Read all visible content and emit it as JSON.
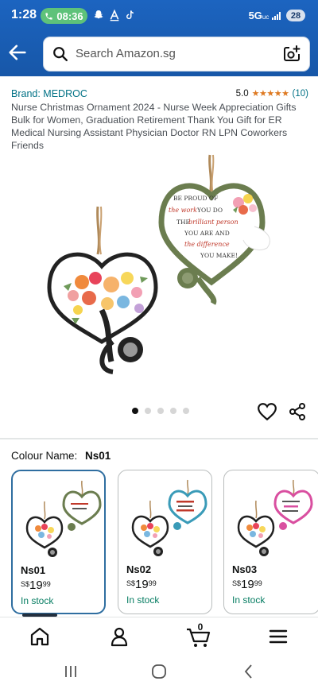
{
  "status_bar": {
    "time": "1:28",
    "call_time": "08:36",
    "network": "5G",
    "network_suffix": "uc",
    "battery": "28"
  },
  "header": {
    "search_placeholder": "Search Amazon.sg"
  },
  "product": {
    "brand": "Brand: MEDROC",
    "rating_value": "5.0",
    "rating_count": "(10)",
    "stars": 5,
    "title": "Nurse Christmas Ornament 2024 - Nurse Week Appreciation Gifts Bulk for Women, Graduation Retirement Thank You Gift for ER Medical Nursing Assistant Physician Doctor RN LPN Coworkers Friends"
  },
  "gallery": {
    "image_count": 5,
    "active_index": 0,
    "ornament_text": [
      "BE PROUD OF",
      "the work",
      "YOU DO",
      "THE",
      "brilliant person",
      "YOU ARE AND",
      "the difference",
      "YOU MAKE!"
    ]
  },
  "colour": {
    "label": "Colour Name:",
    "selected": "Ns01",
    "variants": [
      {
        "name": "Ns01",
        "currency": "S$",
        "whole": "19",
        "fraction": "99",
        "stock": "In stock",
        "accent": "#6b7d4f"
      },
      {
        "name": "Ns02",
        "currency": "S$",
        "whole": "19",
        "fraction": "99",
        "stock": "In stock",
        "accent": "#3a9bb8"
      },
      {
        "name": "Ns03",
        "currency": "S$",
        "whole": "19",
        "fraction": "99",
        "stock": "In stock",
        "accent": "#d94fa0"
      }
    ]
  },
  "bottom_nav": {
    "cart_count": "0",
    "items": [
      "home-icon",
      "account-icon",
      "cart-icon",
      "menu-icon"
    ]
  },
  "colors": {
    "header_blue": "#1a5fb4",
    "link": "#007185",
    "star": "#de7921",
    "in_stock": "#067d62"
  }
}
